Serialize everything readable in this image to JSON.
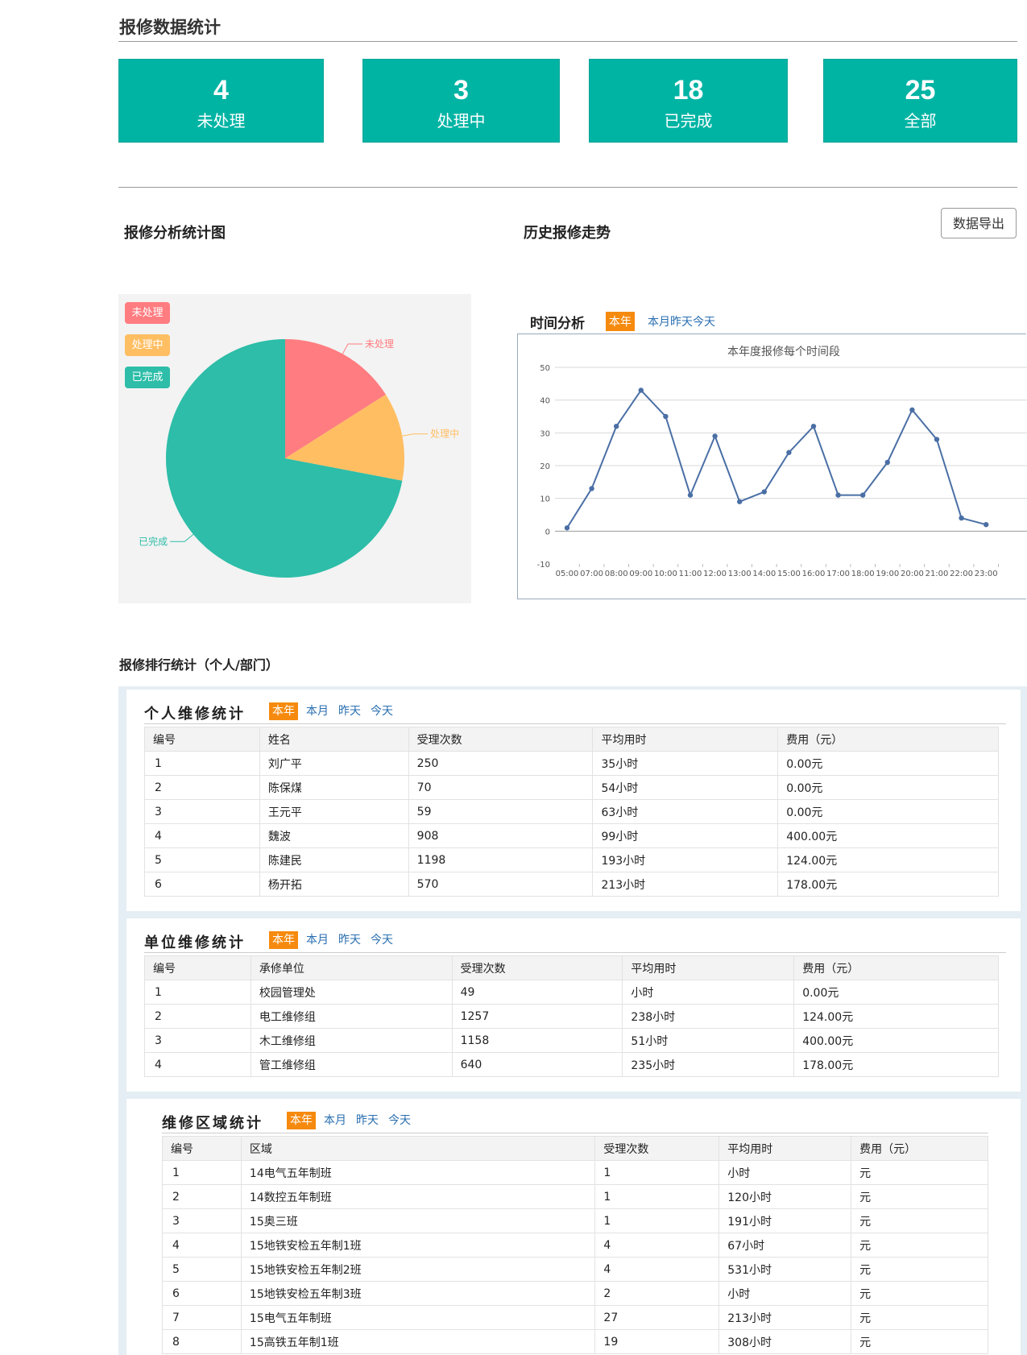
{
  "page_title": "报修数据统计",
  "stats": [
    {
      "value": "4",
      "label": "未处理"
    },
    {
      "value": "3",
      "label": "处理中"
    },
    {
      "value": "18",
      "label": "已完成"
    },
    {
      "value": "25",
      "label": "全部"
    }
  ],
  "analysis": {
    "pie_heading": "报修分析统计图",
    "trend_heading": "历史报修走势",
    "export_label": "数据导出"
  },
  "pie": {
    "legend": [
      "未处理",
      "处理中",
      "已完成"
    ],
    "colors": {
      "unprocessed": "#ff7c80",
      "processing": "#ffbe62",
      "done": "#2dbda8"
    }
  },
  "trend": {
    "tab_title": "时间分析",
    "filters": [
      "本年",
      "本月",
      "昨天",
      "今天"
    ],
    "line_color": "#4a6fa5"
  },
  "chart_data": [
    {
      "type": "pie",
      "categories": [
        "未处理",
        "处理中",
        "已完成"
      ],
      "values": [
        4,
        3,
        18
      ],
      "title": "",
      "legend": "top-left"
    },
    {
      "type": "line",
      "title": "本年度报修每个时间段",
      "x": [
        "05:00",
        "07:00",
        "08:00",
        "09:00",
        "10:00",
        "11:00",
        "12:00",
        "13:00",
        "14:00",
        "15:00",
        "16:00",
        "17:00",
        "18:00",
        "19:00",
        "20:00",
        "21:00",
        "22:00",
        "23:00"
      ],
      "series": [
        {
          "values": [
            1,
            13,
            32,
            43,
            35,
            11,
            29,
            9,
            12,
            24,
            32,
            11,
            11,
            21,
            37,
            28,
            4,
            2
          ]
        }
      ],
      "yticks": [
        "50",
        "40",
        "30",
        "20",
        "10",
        "0",
        "-10"
      ],
      "ylim": [
        -10,
        50
      ],
      "grid": true,
      "xlabel": "",
      "ylabel": ""
    }
  ],
  "ranking": {
    "heading": "报修排行统计（个人/部门）",
    "filters": [
      "本年",
      "本月",
      "昨天",
      "今天"
    ],
    "personal": {
      "title": "个人维修统计",
      "columns": [
        "编号",
        "姓名",
        "受理次数",
        "平均用时",
        "费用（元）"
      ],
      "rows": [
        [
          "1",
          "刘广平",
          "250",
          "35小时",
          "0.00元"
        ],
        [
          "2",
          "陈保煤",
          "70",
          "54小时",
          "0.00元"
        ],
        [
          "3",
          "王元平",
          "59",
          "63小时",
          "0.00元"
        ],
        [
          "4",
          "魏波",
          "908",
          "99小时",
          "400.00元"
        ],
        [
          "5",
          "陈建民",
          "1198",
          "193小时",
          "124.00元"
        ],
        [
          "6",
          "杨开拓",
          "570",
          "213小时",
          "178.00元"
        ]
      ]
    },
    "unit": {
      "title": "单位维修统计",
      "columns": [
        "编号",
        "承修单位",
        "受理次数",
        "平均用时",
        "费用（元）"
      ],
      "rows": [
        [
          "1",
          "校园管理处",
          "49",
          "小时",
          "0.00元"
        ],
        [
          "2",
          "电工维修组",
          "1257",
          "238小时",
          "124.00元"
        ],
        [
          "3",
          "木工维修组",
          "1158",
          "51小时",
          "400.00元"
        ],
        [
          "4",
          "管工维修组",
          "640",
          "235小时",
          "178.00元"
        ]
      ]
    },
    "area": {
      "title": "维修区域统计",
      "columns": [
        "编号",
        "区域",
        "受理次数",
        "平均用时",
        "费用（元）"
      ],
      "rows": [
        [
          "1",
          "14电气五年制班",
          "1",
          "小时",
          "元"
        ],
        [
          "2",
          "14数控五年制班",
          "1",
          "120小时",
          "元"
        ],
        [
          "3",
          "15奥三班",
          "1",
          "191小时",
          "元"
        ],
        [
          "4",
          "15地铁安检五年制1班",
          "4",
          "67小时",
          "元"
        ],
        [
          "5",
          "15地铁安检五年制2班",
          "4",
          "531小时",
          "元"
        ],
        [
          "6",
          "15地铁安检五年制3班",
          "2",
          "小时",
          "元"
        ],
        [
          "7",
          "15电气五年制班",
          "27",
          "213小时",
          "元"
        ],
        [
          "8",
          "15高铁五年制1班",
          "19",
          "308小时",
          "元"
        ]
      ]
    }
  }
}
